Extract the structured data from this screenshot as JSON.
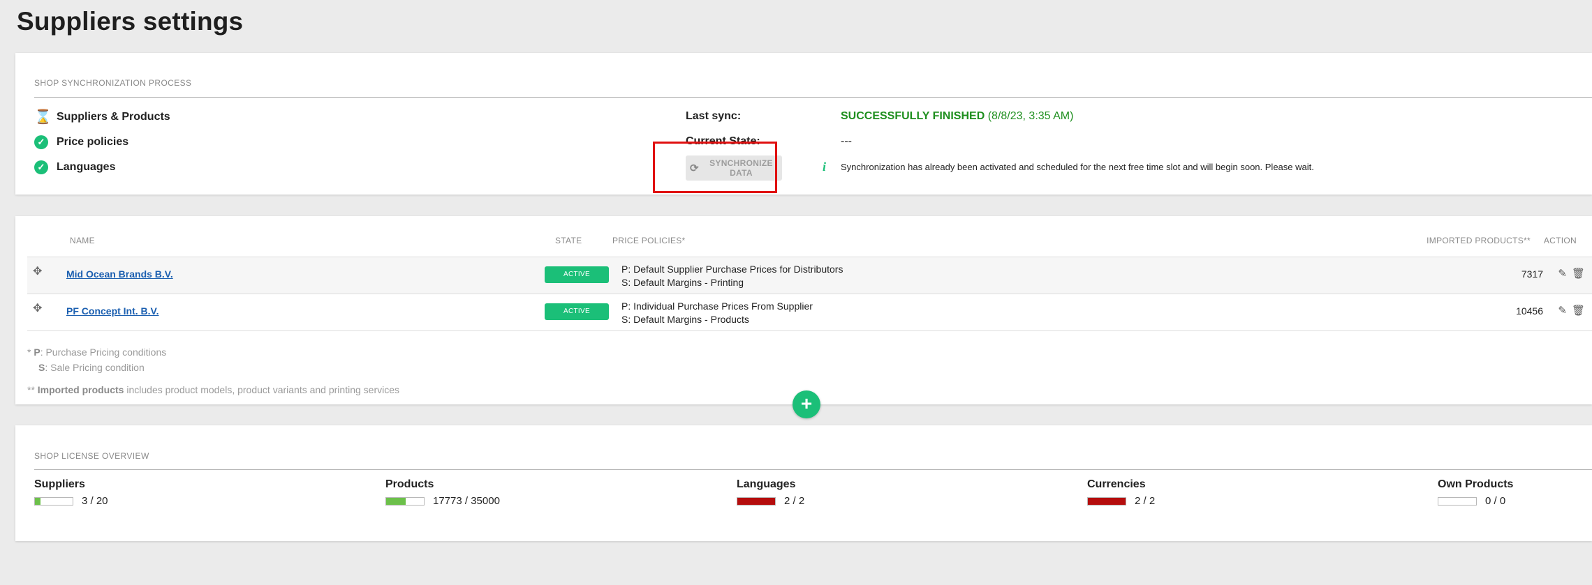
{
  "page": {
    "title": "Suppliers settings"
  },
  "sync": {
    "section_title": "SHOP SYNCHRONIZATION PROCESS",
    "steps": [
      {
        "label": "Suppliers & Products",
        "icon": "hourglass-icon"
      },
      {
        "label": "Price policies",
        "icon": "check-circle-icon"
      },
      {
        "label": "Languages",
        "icon": "check-circle-icon"
      }
    ],
    "last_sync_label": "Last sync:",
    "last_sync_status": "SUCCESSFULLY FINISHED",
    "last_sync_date": "(8/8/23, 3:35 AM)",
    "current_state_label": "Current State:",
    "current_state_value": "---",
    "button_label": "SYNCHRONIZE DATA",
    "info_symbol": "i",
    "note": "Synchronization has already been activated and scheduled for the next free time slot and will begin soon. Please wait.",
    "highlight_color": "#e01010"
  },
  "suppliers": {
    "headers": {
      "name": "NAME",
      "state": "STATE",
      "price_policies": "PRICE POLICIES*",
      "imported": "IMPORTED PRODUCTS**",
      "action": "ACTION"
    },
    "rows": [
      {
        "name": "Mid Ocean Brands B.V.",
        "state": "ACTIVE",
        "policy_p": "P: Default Supplier Purchase Prices for Distributors",
        "policy_s": "S: Default Margins - Printing",
        "imported": "7317"
      },
      {
        "name": "PF Concept Int. B.V.",
        "state": "ACTIVE",
        "policy_p": "P: Individual Purchase Prices From Supplier",
        "policy_s": "S: Default Margins - Products",
        "imported": "10456"
      }
    ],
    "footnotes": {
      "p_prefix": "* ",
      "p_key": "P",
      "p_text": ": Purchase Pricing conditions",
      "s_key": "S",
      "s_text": ": Sale Pricing condition",
      "imp_prefix": "** ",
      "imp_key": "Imported products",
      "imp_text": " includes product models, product variants and printing services"
    },
    "add_symbol": "+"
  },
  "license": {
    "section_title": "SHOP LICENSE OVERVIEW",
    "items": [
      {
        "title": "Suppliers",
        "value": "3 / 20",
        "fill": 0.15,
        "color": "#6cc04a"
      },
      {
        "title": "Products",
        "value": "17773 / 35000",
        "fill": 0.51,
        "color": "#6cc04a"
      },
      {
        "title": "Languages",
        "value": "2 / 2",
        "fill": 1.0,
        "color": "#b50d0d"
      },
      {
        "title": "Currencies",
        "value": "2 / 2",
        "fill": 1.0,
        "color": "#b50d0d"
      },
      {
        "title": "Own Products",
        "value": "0 / 0",
        "fill": 0,
        "color": "#6cc04a"
      }
    ]
  }
}
